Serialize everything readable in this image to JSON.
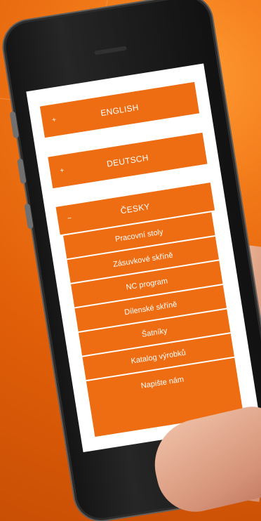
{
  "languages": {
    "english": "ENGLISH",
    "deutsch": "DEUTSCH",
    "cesky": "ČESKY"
  },
  "menu": [
    "Pracovní stoly",
    "Zásuvkové skříně",
    "NC program",
    "Dílenské skříně",
    "Šatníky",
    "Katalog výrobků",
    "Napište nám"
  ],
  "icons": {
    "expand": "plus",
    "collapse": "minus"
  },
  "colors": {
    "accent": "#ef6d12",
    "background": "#e8660f"
  }
}
